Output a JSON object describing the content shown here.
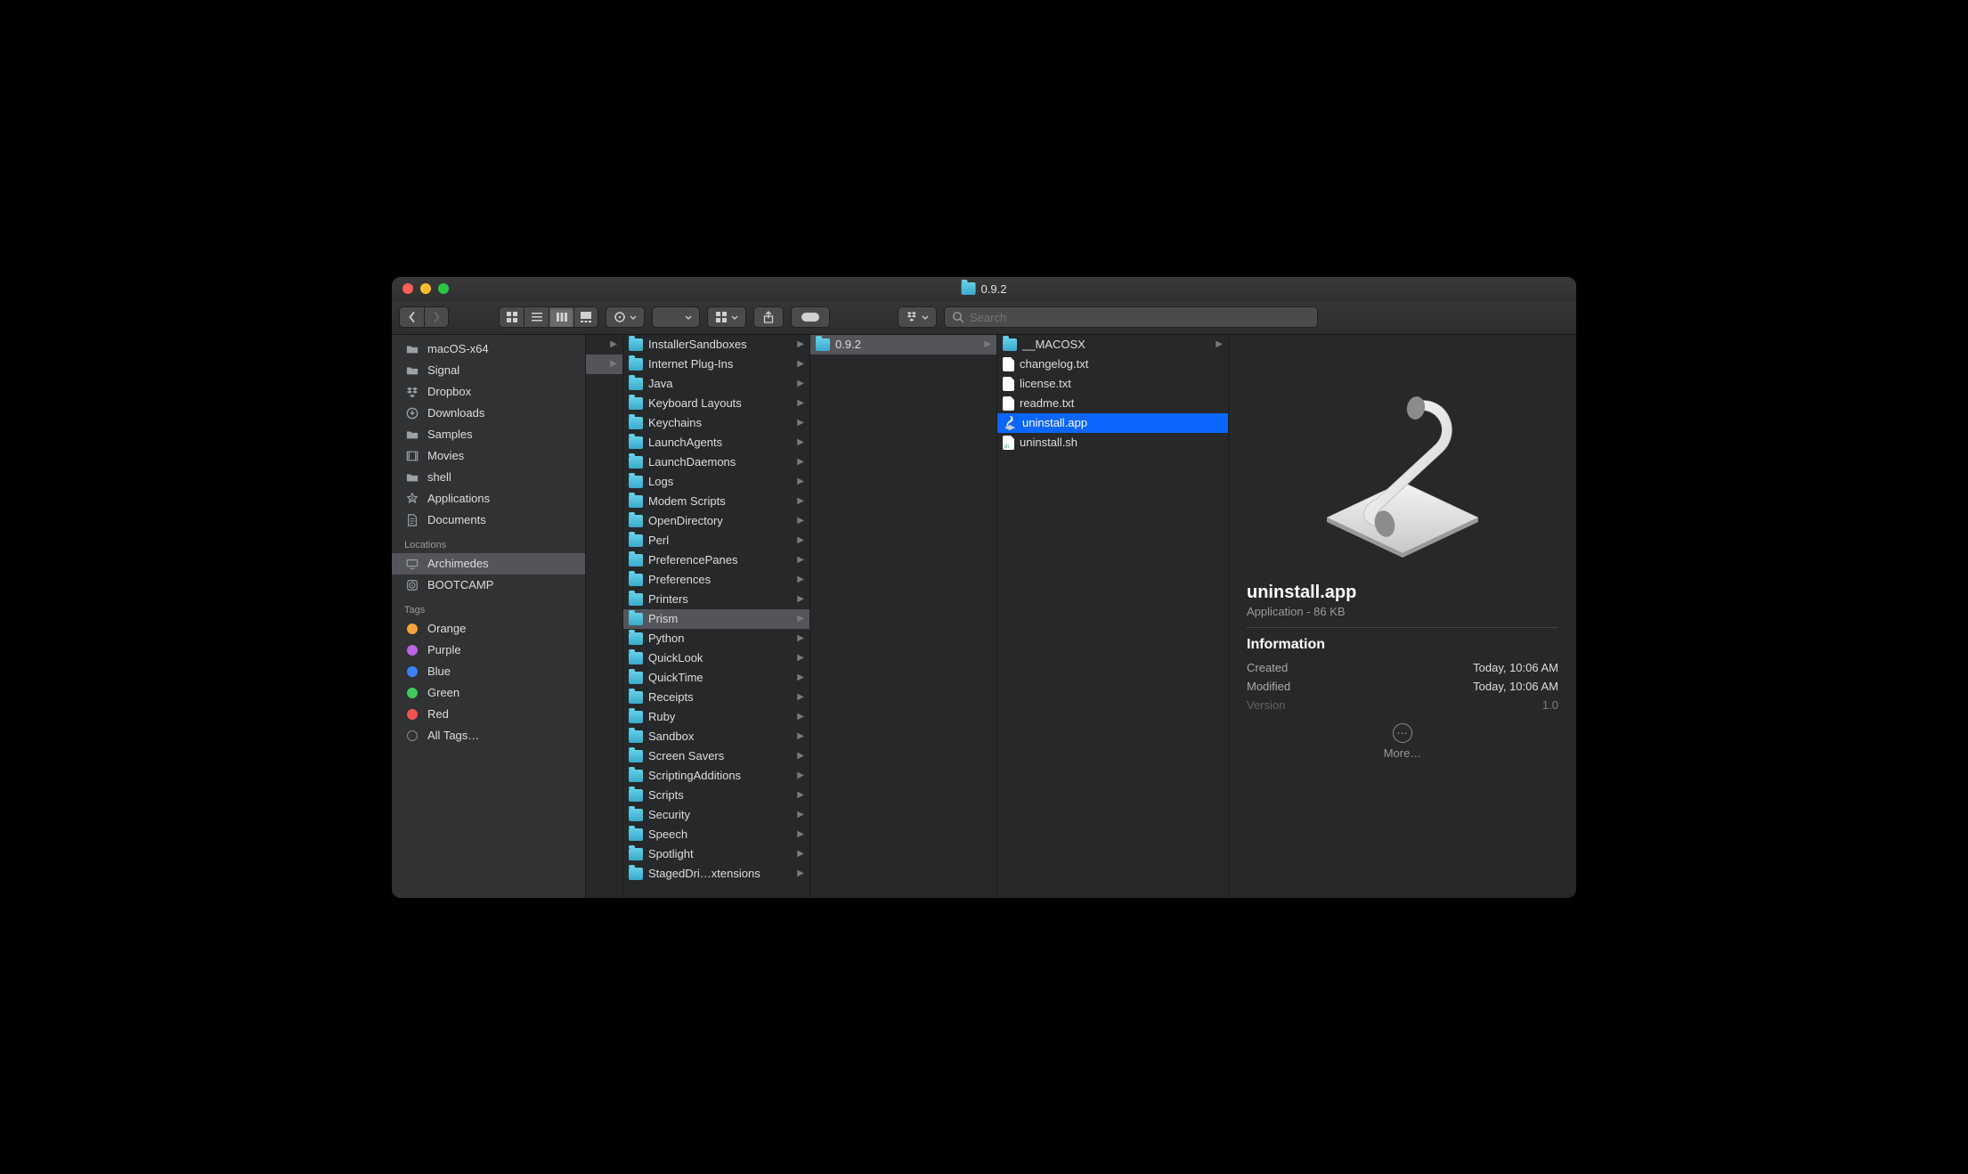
{
  "window_title": "0.9.2",
  "search_placeholder": "Search",
  "sidebar": {
    "favorites": [
      {
        "label": "macOS-x64",
        "icon": "folder"
      },
      {
        "label": "Signal",
        "icon": "folder"
      },
      {
        "label": "Dropbox",
        "icon": "dropbox"
      },
      {
        "label": "Downloads",
        "icon": "downloads"
      },
      {
        "label": "Samples",
        "icon": "folder"
      },
      {
        "label": "Movies",
        "icon": "movies"
      },
      {
        "label": "shell",
        "icon": "folder"
      },
      {
        "label": "Applications",
        "icon": "applications"
      },
      {
        "label": "Documents",
        "icon": "documents"
      }
    ],
    "locations_header": "Locations",
    "locations": [
      {
        "label": "Archimedes",
        "icon": "computer",
        "selected": true
      },
      {
        "label": "BOOTCAMP",
        "icon": "disk"
      }
    ],
    "tags_header": "Tags",
    "tags": [
      {
        "label": "Orange",
        "color": "#f6a53c"
      },
      {
        "label": "Purple",
        "color": "#b963e6"
      },
      {
        "label": "Blue",
        "color": "#3a82f7"
      },
      {
        "label": "Green",
        "color": "#3fc959"
      },
      {
        "label": "Red",
        "color": "#ef5350"
      },
      {
        "label": "All Tags…",
        "color": null
      }
    ]
  },
  "column1": [
    {
      "label": "InstallerSandboxes",
      "type": "folder"
    },
    {
      "label": "Internet Plug-Ins",
      "type": "folder"
    },
    {
      "label": "Java",
      "type": "folder"
    },
    {
      "label": "Keyboard Layouts",
      "type": "folder"
    },
    {
      "label": "Keychains",
      "type": "folder"
    },
    {
      "label": "LaunchAgents",
      "type": "folder"
    },
    {
      "label": "LaunchDaemons",
      "type": "folder"
    },
    {
      "label": "Logs",
      "type": "folder"
    },
    {
      "label": "Modem Scripts",
      "type": "folder"
    },
    {
      "label": "OpenDirectory",
      "type": "folder"
    },
    {
      "label": "Perl",
      "type": "folder"
    },
    {
      "label": "PreferencePanes",
      "type": "folder"
    },
    {
      "label": "Preferences",
      "type": "folder"
    },
    {
      "label": "Printers",
      "type": "folder"
    },
    {
      "label": "Prism",
      "type": "folder",
      "selected": true
    },
    {
      "label": "Python",
      "type": "folder"
    },
    {
      "label": "QuickLook",
      "type": "folder"
    },
    {
      "label": "QuickTime",
      "type": "folder"
    },
    {
      "label": "Receipts",
      "type": "folder"
    },
    {
      "label": "Ruby",
      "type": "folder"
    },
    {
      "label": "Sandbox",
      "type": "folder"
    },
    {
      "label": "Screen Savers",
      "type": "folder"
    },
    {
      "label": "ScriptingAdditions",
      "type": "folder"
    },
    {
      "label": "Scripts",
      "type": "folder"
    },
    {
      "label": "Security",
      "type": "folder"
    },
    {
      "label": "Speech",
      "type": "folder"
    },
    {
      "label": "Spotlight",
      "type": "folder"
    },
    {
      "label": "StagedDri…xtensions",
      "type": "folder"
    }
  ],
  "column2": [
    {
      "label": "0.9.2",
      "type": "folder",
      "selected": true
    }
  ],
  "column3": [
    {
      "label": "__MACOSX",
      "type": "folder",
      "chev": true
    },
    {
      "label": "changelog.txt",
      "type": "file"
    },
    {
      "label": "license.txt",
      "type": "file"
    },
    {
      "label": "readme.txt",
      "type": "file"
    },
    {
      "label": "uninstall.app",
      "type": "app",
      "selected": true
    },
    {
      "label": "uninstall.sh",
      "type": "sh"
    }
  ],
  "preview": {
    "name": "uninstall.app",
    "subtitle": "Application - 86 KB",
    "info_header": "Information",
    "rows": [
      {
        "k": "Created",
        "v": "Today, 10:06 AM"
      },
      {
        "k": "Modified",
        "v": "Today, 10:06 AM"
      },
      {
        "k": "Version",
        "v": "1.0",
        "fade": true
      }
    ],
    "more_label": "More…"
  }
}
